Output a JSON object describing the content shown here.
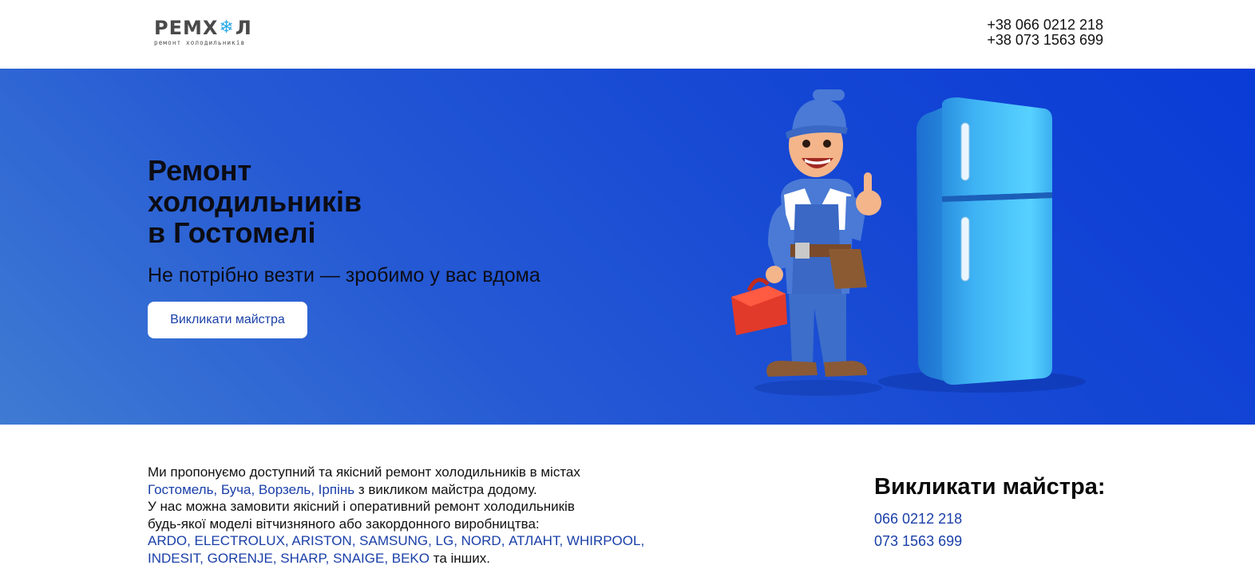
{
  "header": {
    "logo": {
      "main_prefix": "РЕМХ",
      "main_suffix": "Л",
      "snow_icon": "❄",
      "tagline": "ремонт холодильників"
    },
    "phones": [
      "+38 066 0212 218",
      "+38 073 1563 699"
    ]
  },
  "hero": {
    "title": "Ремонт\nхолодильників\nв Гостомелі",
    "subtitle": "Не потрібно везти — зробимо у вас вдома",
    "cta_label": "Викликати майстра",
    "illustration": {
      "icons": [
        "repairman-icon",
        "refrigerator-icon"
      ]
    }
  },
  "content": {
    "line1": "Ми пропонуємо доступний та якісний ремонт холодильників в містах",
    "cities": "Гостомель, Буча, Ворзель, Ірпінь",
    "line2_rest": " з викликом майстра додому.",
    "line3": "У нас можна замовити якісний і оперативний ремонт холодильників",
    "line4": "будь-якої моделі вітчизняного або закордонного виробництва:",
    "brands1": "ARDO, ELECTROLUX, ARISTON, SAMSUNG, LG, NORD, АТЛАНТ, WHIRPOOL,",
    "brands2": "INDESIT, GORENJE, SHARP, SNAIGE, BEKO",
    "brands_rest": " та інших."
  },
  "call": {
    "title": "Викликати майстра:",
    "phones": [
      "066 0212 218",
      "073 1563 699"
    ]
  },
  "colors": {
    "accent": "#1a3fa8",
    "hero_start": "#3f7bd3",
    "hero_end": "#0a3bd6"
  }
}
